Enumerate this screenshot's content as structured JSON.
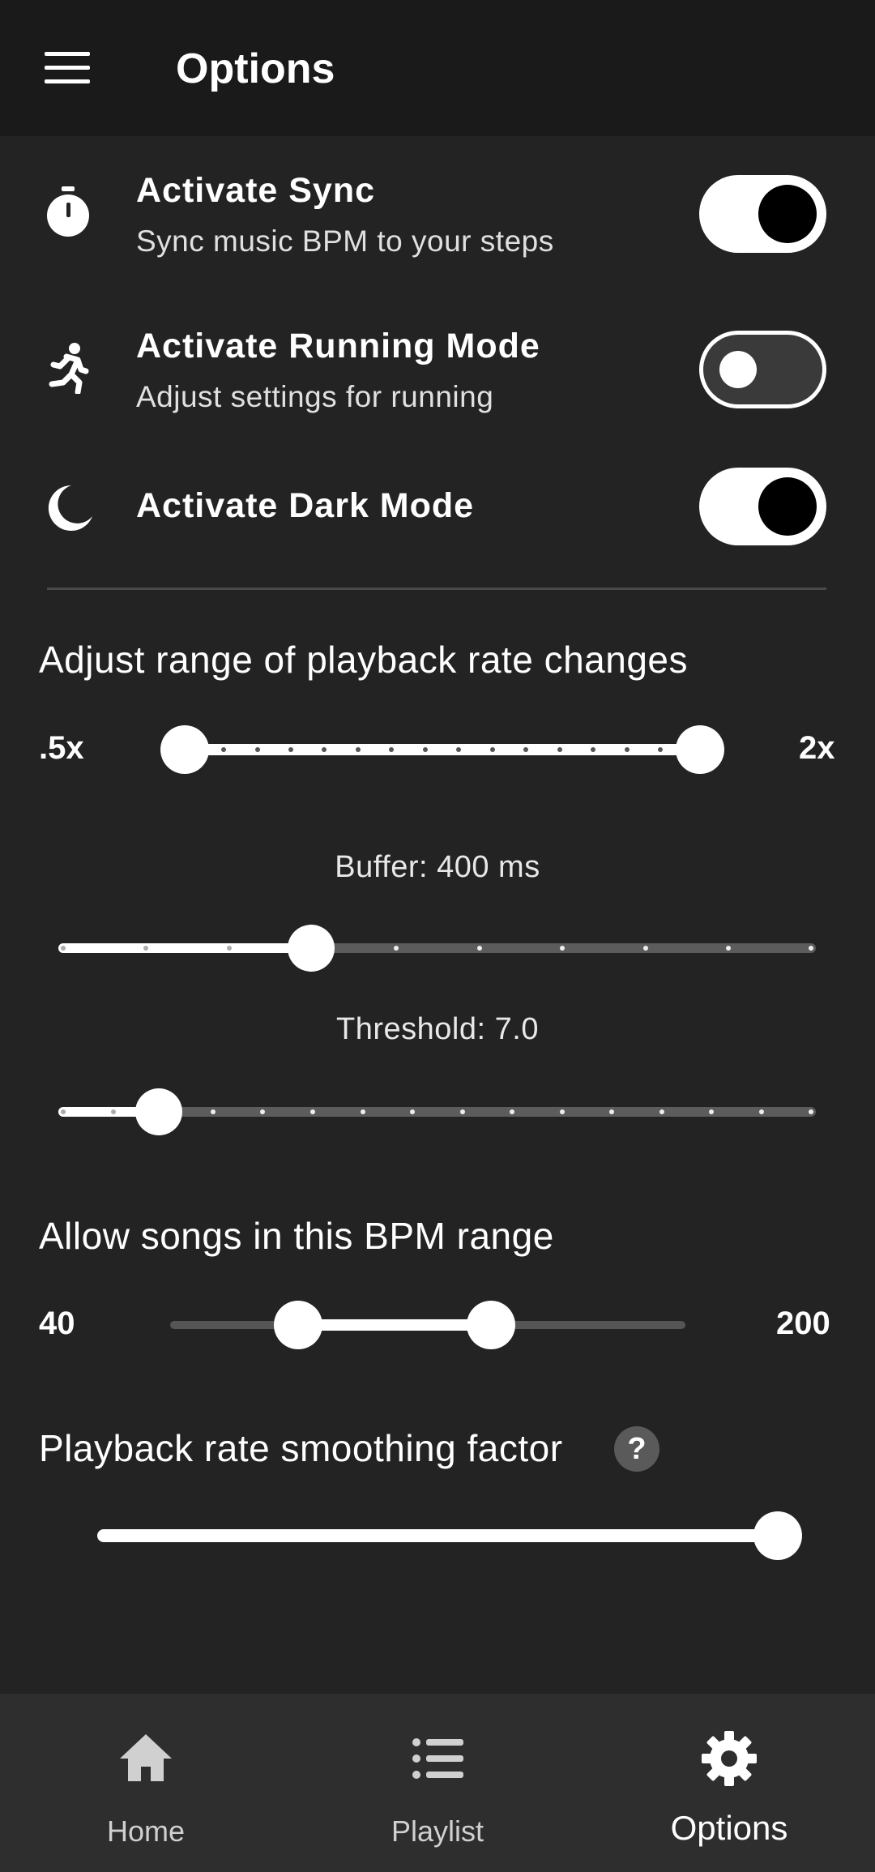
{
  "appbar": {
    "title": "Options"
  },
  "toggles": [
    {
      "title": "Activate Sync",
      "subtitle": "Sync music BPM to your steps",
      "icon": "stopwatch-icon",
      "on": true
    },
    {
      "title": "Activate Running Mode",
      "subtitle": "Adjust settings for running",
      "icon": "running-icon",
      "on": false
    },
    {
      "title": "Activate Dark Mode",
      "icon": "moon-icon",
      "on": true
    }
  ],
  "playback_range": {
    "title": "Adjust range of playback rate changes",
    "min_label": ".5x",
    "max_label": "2x"
  },
  "buffer": {
    "label": "Buffer: 400 ms"
  },
  "threshold": {
    "label": "Threshold: 7.0"
  },
  "bpm_range": {
    "title": "Allow songs in this BPM range",
    "min_label": "40",
    "max_label": "200"
  },
  "smoothing": {
    "title": "Playback rate smoothing factor",
    "help": "?"
  },
  "nav": {
    "items": [
      {
        "label": "Home",
        "icon": "home-icon"
      },
      {
        "label": "Playlist",
        "icon": "list-icon"
      },
      {
        "label": "Options",
        "icon": "gear-icon",
        "active": true
      }
    ]
  }
}
